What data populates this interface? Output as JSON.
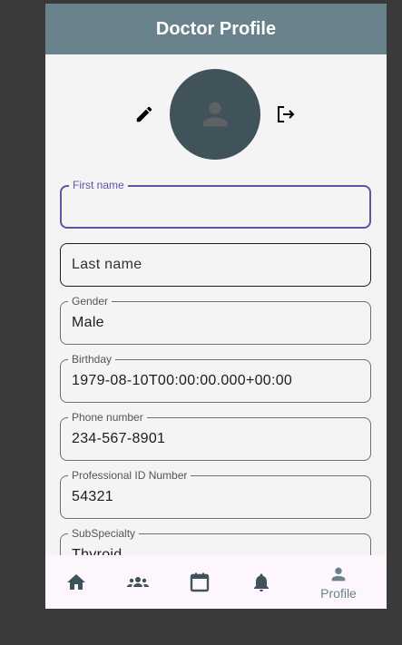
{
  "header": {
    "title": "Doctor Profile"
  },
  "profile": {
    "edit_icon": "pencil-icon",
    "logout_icon": "logout-icon",
    "avatar_icon": "person-icon"
  },
  "fields": [
    {
      "label": "First name",
      "value": "",
      "placeholder": ""
    },
    {
      "label": "",
      "value": "",
      "placeholder": "Last name"
    },
    {
      "label": "Gender",
      "value": "Male"
    },
    {
      "label": "Birthday",
      "value": "1979-08-10T00:00:00.000+00:00"
    },
    {
      "label": "Phone number",
      "value": "234-567-8901"
    },
    {
      "label": "Professional ID Number",
      "value": "54321"
    },
    {
      "label": "SubSpecialty",
      "value": "Thyroid"
    }
  ],
  "nav": {
    "items": [
      {
        "icon": "home-icon"
      },
      {
        "icon": "group-icon"
      },
      {
        "icon": "calendar-icon"
      },
      {
        "icon": "bell-icon"
      },
      {
        "icon": "person-icon",
        "label": "Profile"
      }
    ]
  },
  "colors": {
    "appbar": "#6a828c",
    "focus": "#6750a4",
    "avatar": "#40535b"
  }
}
